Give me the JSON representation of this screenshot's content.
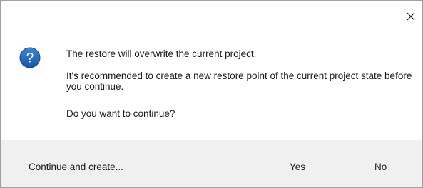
{
  "dialog": {
    "close_icon": "close-icon",
    "question_icon": "question-mark-icon",
    "accent_color": "#1a62b8",
    "footer_color": "#f0f0f0",
    "messages": {
      "line1": "The restore will overwrite the current project.",
      "line2": "It's recommended to create a new restore point of the current project state before you continue.",
      "line3": "Do you want to continue?"
    },
    "buttons": {
      "continue_create": "Continue and create...",
      "yes": "Yes",
      "no": "No"
    }
  }
}
